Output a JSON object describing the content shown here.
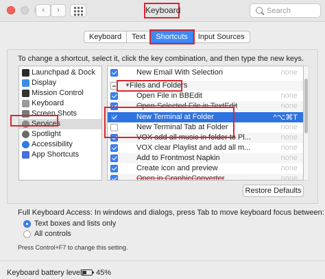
{
  "window": {
    "title": "Keyboard",
    "back_glyph": "‹",
    "forward_glyph": "›",
    "search_placeholder": "Search"
  },
  "tabs": [
    {
      "label": "Keyboard",
      "active": false
    },
    {
      "label": "Text",
      "active": false
    },
    {
      "label": "Shortcuts",
      "active": true
    },
    {
      "label": "Input Sources",
      "active": false
    }
  ],
  "instructions": "To change a shortcut, select it, click the key combination, and then type the new keys.",
  "categories": [
    {
      "label": "Launchpad & Dock",
      "icon": "launchpad-icon",
      "color": "#2b2b2b"
    },
    {
      "label": "Display",
      "icon": "display-icon",
      "color": "#3a8ee6"
    },
    {
      "label": "Mission Control",
      "icon": "mission-control-icon",
      "color": "#333333"
    },
    {
      "label": "Keyboard",
      "icon": "keyboard-icon",
      "color": "#9a9a9a"
    },
    {
      "label": "Screen Shots",
      "icon": "screenshot-icon",
      "color": "#7a7a7a"
    },
    {
      "label": "Services",
      "icon": "gear-icon",
      "color": "#8a8a8a"
    },
    {
      "label": "Spotlight",
      "icon": "spotlight-icon",
      "color": "#6a6a6a"
    },
    {
      "label": "Accessibility",
      "icon": "accessibility-icon",
      "color": "#2f7ae5"
    },
    {
      "label": "App Shortcuts",
      "icon": "app-shortcuts-icon",
      "color": "#4a6ee0"
    }
  ],
  "shortcuts": [
    {
      "label": "New Email With Selection",
      "state": "checked",
      "keys": "none"
    },
    {
      "group": "Files and Folders",
      "state": "dash"
    },
    {
      "label": "Open File in BBEdit",
      "state": "checked",
      "keys": "none"
    },
    {
      "label": "Open Selected File in TextEdit",
      "state": "checked",
      "keys": "none",
      "strike": true
    },
    {
      "label": "New Terminal at Folder",
      "state": "checked",
      "keys": "^⌥⌘T",
      "selected": true
    },
    {
      "label": "New Terminal Tab at Folder",
      "state": "unchecked",
      "keys": "none"
    },
    {
      "label": "VOX add all music in folder to Pl...",
      "state": "checked",
      "keys": "none"
    },
    {
      "label": "VOX clear Playlist and add all m...",
      "state": "checked",
      "keys": "none"
    },
    {
      "label": "Add to Frontmost Napkin",
      "state": "checked",
      "keys": "none"
    },
    {
      "label": "Create icon and preview",
      "state": "checked",
      "keys": "none"
    },
    {
      "label": "Open in GraphicConverter",
      "state": "checked",
      "keys": "none",
      "strike": true
    }
  ],
  "restore_button": "Restore Defaults",
  "full_keyboard_access": {
    "text": "Full Keyboard Access: In windows and dialogs, press Tab to move keyboard focus between:",
    "options": [
      {
        "label": "Text boxes and lists only",
        "selected": true
      },
      {
        "label": "All controls",
        "selected": false
      }
    ],
    "hint": "Press Control+F7 to change this setting."
  },
  "battery": {
    "label": "Keyboard battery level:",
    "value": "45%",
    "level": 0.45
  },
  "colors": {
    "accent": "#3d8af7",
    "selection": "#2f73e0",
    "annotation": "#d8262c"
  }
}
